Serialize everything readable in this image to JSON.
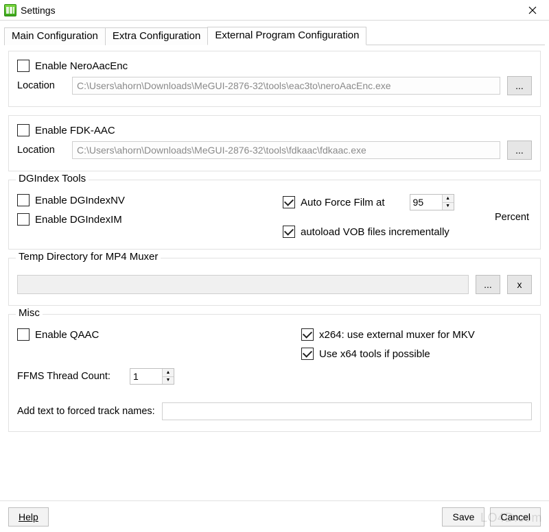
{
  "window": {
    "title": "Settings"
  },
  "tabs": {
    "main": "Main Configuration",
    "extra": "Extra Configuration",
    "external": "External Program Configuration"
  },
  "nero": {
    "enable_label": "Enable NeroAacEnc",
    "enable_checked": false,
    "location_label": "Location",
    "location_value": "C:\\Users\\ahorn\\Downloads\\MeGUI-2876-32\\tools\\eac3to\\neroAacEnc.exe",
    "browse_label": "..."
  },
  "fdk": {
    "enable_label": "Enable FDK-AAC",
    "enable_checked": false,
    "location_label": "Location",
    "location_value": "C:\\Users\\ahorn\\Downloads\\MeGUI-2876-32\\tools\\fdkaac\\fdkaac.exe",
    "browse_label": "..."
  },
  "dgindex": {
    "title": "DGIndex Tools",
    "enable_nv_label": "Enable DGIndexNV",
    "enable_nv_checked": false,
    "enable_im_label": "Enable DGIndexIM",
    "enable_im_checked": false,
    "auto_force_label": "Auto Force Film at",
    "auto_force_checked": true,
    "auto_force_value": "95",
    "percent_label": "Percent",
    "autoload_vob_label": "autoload VOB files incrementally",
    "autoload_vob_checked": true
  },
  "temp": {
    "title": "Temp Directory for MP4 Muxer",
    "value": "",
    "browse_label": "...",
    "clear_label": "x"
  },
  "misc": {
    "title": "Misc",
    "enable_qaac_label": "Enable QAAC",
    "enable_qaac_checked": false,
    "x264_mkv_label": "x264: use external muxer for MKV",
    "x264_mkv_checked": true,
    "x64_tools_label": "Use x64 tools if possible",
    "x64_tools_checked": true,
    "ffms_label": "FFMS Thread Count:",
    "ffms_value": "1",
    "forced_text_label": "Add text to forced track names:",
    "forced_text_value": ""
  },
  "buttons": {
    "help": "Help",
    "save": "Save",
    "cancel": "Cancel"
  },
  "watermark": "LO4D.com"
}
